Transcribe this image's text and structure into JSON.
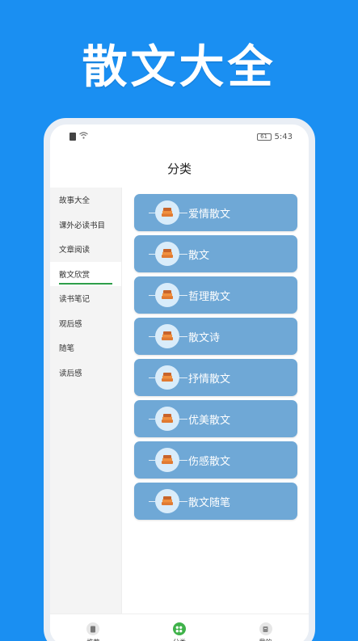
{
  "banner": {
    "title": "散文大全"
  },
  "status_bar": {
    "battery": "61",
    "time": "5:43"
  },
  "header": {
    "title": "分类"
  },
  "sidebar": {
    "items": [
      {
        "label": "故事大全",
        "active": false
      },
      {
        "label": "课外必读书目",
        "active": false
      },
      {
        "label": "文章阅读",
        "active": false
      },
      {
        "label": "散文欣赏",
        "active": true
      },
      {
        "label": "读书笔记",
        "active": false
      },
      {
        "label": "观后感",
        "active": false
      },
      {
        "label": "随笔",
        "active": false
      },
      {
        "label": "读后感",
        "active": false
      }
    ]
  },
  "categories": [
    {
      "label": "爱情散文"
    },
    {
      "label": "散文"
    },
    {
      "label": "哲理散文"
    },
    {
      "label": "散文诗"
    },
    {
      "label": "抒情散文"
    },
    {
      "label": "优美散文"
    },
    {
      "label": "伤感散文"
    },
    {
      "label": "散文随笔"
    }
  ],
  "tabbar": {
    "tabs": [
      {
        "label": "推荐",
        "icon": "book-icon",
        "active": false
      },
      {
        "label": "分类",
        "icon": "grid-icon",
        "active": true
      },
      {
        "label": "我的",
        "icon": "profile-icon",
        "active": false
      }
    ]
  },
  "colors": {
    "background": "#1a8ff2",
    "card": "#6fa8d6",
    "accent": "#3fb24a"
  }
}
